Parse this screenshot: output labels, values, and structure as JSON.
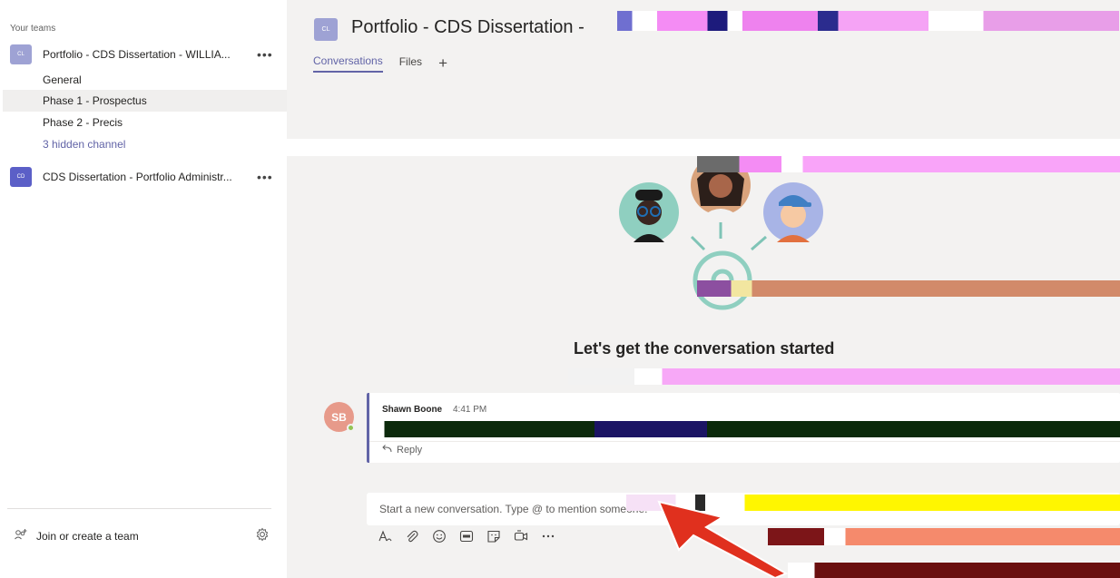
{
  "left_pane": {
    "section_title": "Your teams",
    "teams": [
      {
        "avatar_text": "CL",
        "avatar_color": "#9ea2d4",
        "name": "Portfolio - CDS Dissertation - WILLIA...",
        "more": "•••",
        "channels": [
          {
            "label": "General",
            "active": false
          },
          {
            "label": "Phase 1 - Prospectus",
            "active": true
          },
          {
            "label": "Phase 2 - Precis",
            "active": false
          },
          {
            "label": "3 hidden channel",
            "active": false
          }
        ]
      },
      {
        "avatar_text": "CD",
        "avatar_color": "#5b5fc7",
        "name": "CDS Dissertation - Portfolio Administr...",
        "more": "•••"
      }
    ],
    "join_label": "Join or create a team",
    "join_icon": "join-team-icon",
    "settings_icon": "gear-icon"
  },
  "header": {
    "avatar_text": "CL",
    "title": "Portfolio - CDS Dissertation -",
    "tabs": [
      {
        "label": "Conversations",
        "active": true
      },
      {
        "label": "Files",
        "active": false
      }
    ],
    "add_tab": "+"
  },
  "empty_state": {
    "title": "Let's get the conversation started"
  },
  "message": {
    "avatar_initials": "SB",
    "author": "Shawn Boone",
    "time": "4:41 PM",
    "reply_label": "Reply"
  },
  "compose": {
    "placeholder": "Start a new conversation. Type @ to mention someone.",
    "tools": [
      "format-icon",
      "attach-icon",
      "emoji-icon",
      "gif-icon",
      "sticker-icon",
      "meet-now-icon",
      "more-options-icon"
    ]
  },
  "colors": {
    "accent": "#6264a7",
    "annotation_arrow": "#e0301e",
    "presence_available": "#92c353"
  }
}
